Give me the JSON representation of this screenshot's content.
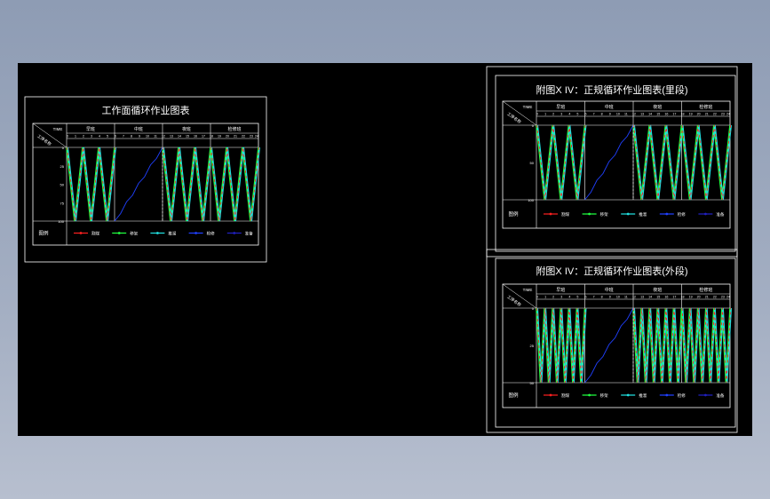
{
  "sheets": [
    {
      "title": "工作面循环作业图表",
      "header_time_label": "TIME",
      "header_row_label": "工序名称",
      "shifts": [
        "早班",
        "中班",
        "夜班",
        "检修班"
      ],
      "hours": [
        "0",
        "1",
        "2",
        "3",
        "4",
        "5",
        "6",
        "7",
        "8",
        "9",
        "10",
        "11",
        "12",
        "13",
        "14",
        "15",
        "16",
        "17",
        "18",
        "19",
        "20",
        "21",
        "22",
        "23",
        "24"
      ],
      "y_ticks": [
        "0",
        "25",
        "50",
        "75",
        "100"
      ],
      "legend_label": "图例",
      "legend": [
        "割煤",
        "移架",
        "推溜",
        "检修",
        "准备"
      ]
    },
    {
      "title": "附图X IV：正规循环作业图表(里段)",
      "header_time_label": "TIME",
      "header_row_label": "工序名称",
      "shifts": [
        "早班",
        "中班",
        "夜班",
        "检修班"
      ],
      "hours": [
        "0",
        "1",
        "2",
        "3",
        "4",
        "5",
        "6",
        "7",
        "8",
        "9",
        "10",
        "11",
        "12",
        "13",
        "14",
        "15",
        "16",
        "17",
        "18",
        "19",
        "20",
        "21",
        "22",
        "23",
        "24"
      ],
      "y_ticks": [
        "0",
        "50",
        "100"
      ],
      "legend_label": "图例",
      "legend": [
        "割煤",
        "移架",
        "推溜",
        "检修",
        "准备"
      ]
    },
    {
      "title": "附图X IV：正规循环作业图表(外段)",
      "header_time_label": "TIME",
      "header_row_label": "工序名称",
      "shifts": [
        "早班",
        "中班",
        "夜班",
        "检修班"
      ],
      "hours": [
        "0",
        "1",
        "2",
        "3",
        "4",
        "5",
        "6",
        "7",
        "8",
        "9",
        "10",
        "11",
        "12",
        "13",
        "14",
        "15",
        "16",
        "17",
        "18",
        "19",
        "20",
        "21",
        "22",
        "23",
        "24"
      ],
      "y_ticks": [
        "0",
        "25",
        "50"
      ],
      "legend_label": "图例",
      "legend": [
        "割煤",
        "移架",
        "推溜",
        "检修",
        "准备"
      ]
    }
  ],
  "colors": {
    "cut": "#ff2020",
    "support": "#20ff40",
    "conveyor": "#20e0e0",
    "maintenance": "#2040ff",
    "prep": "#2020c0",
    "frame": "#ffffff",
    "background": "#000000"
  }
}
